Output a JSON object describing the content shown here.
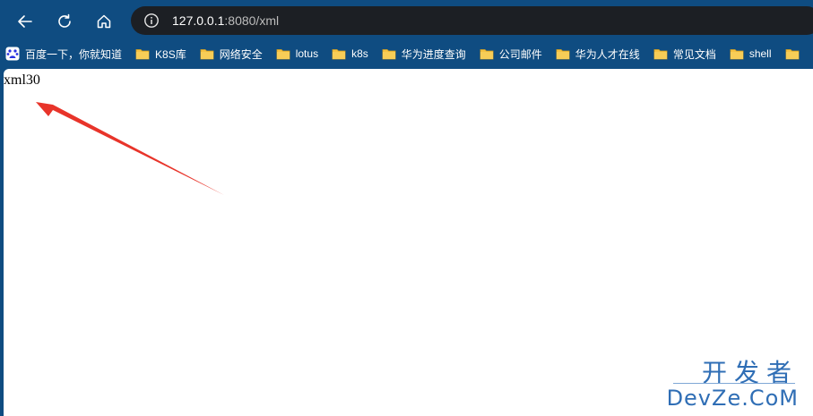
{
  "toolbar": {
    "back_icon": "arrow-left-icon",
    "reload_icon": "reload-icon",
    "home_icon": "home-icon",
    "address": {
      "info_icon": "info-icon",
      "host": "127.0.0.1",
      "rest": ":8080/xml"
    }
  },
  "bookmarks": [
    {
      "label": "百度一下，你就知道",
      "icon": "baidu-paw-icon"
    },
    {
      "label": "K8S库",
      "icon": "folder-icon"
    },
    {
      "label": "网络安全",
      "icon": "folder-icon"
    },
    {
      "label": "lotus",
      "icon": "folder-icon"
    },
    {
      "label": "k8s",
      "icon": "folder-icon"
    },
    {
      "label": "华为进度查询",
      "icon": "folder-icon"
    },
    {
      "label": "公司邮件",
      "icon": "folder-icon"
    },
    {
      "label": "华为人才在线",
      "icon": "folder-icon"
    },
    {
      "label": "常见文档",
      "icon": "folder-icon"
    },
    {
      "label": "shell",
      "icon": "folder-icon"
    },
    {
      "label": "",
      "icon": "folder-icon"
    }
  ],
  "page": {
    "body_text": "xml30"
  },
  "watermark": {
    "chinese": "开发者",
    "english": "DevZe.CoM"
  },
  "colors": {
    "frame": "#0f4c81",
    "address_bg": "#1c1f24",
    "folder": "#f5c243",
    "arrow": "#e8342a",
    "watermark": "#2f6eb5"
  }
}
